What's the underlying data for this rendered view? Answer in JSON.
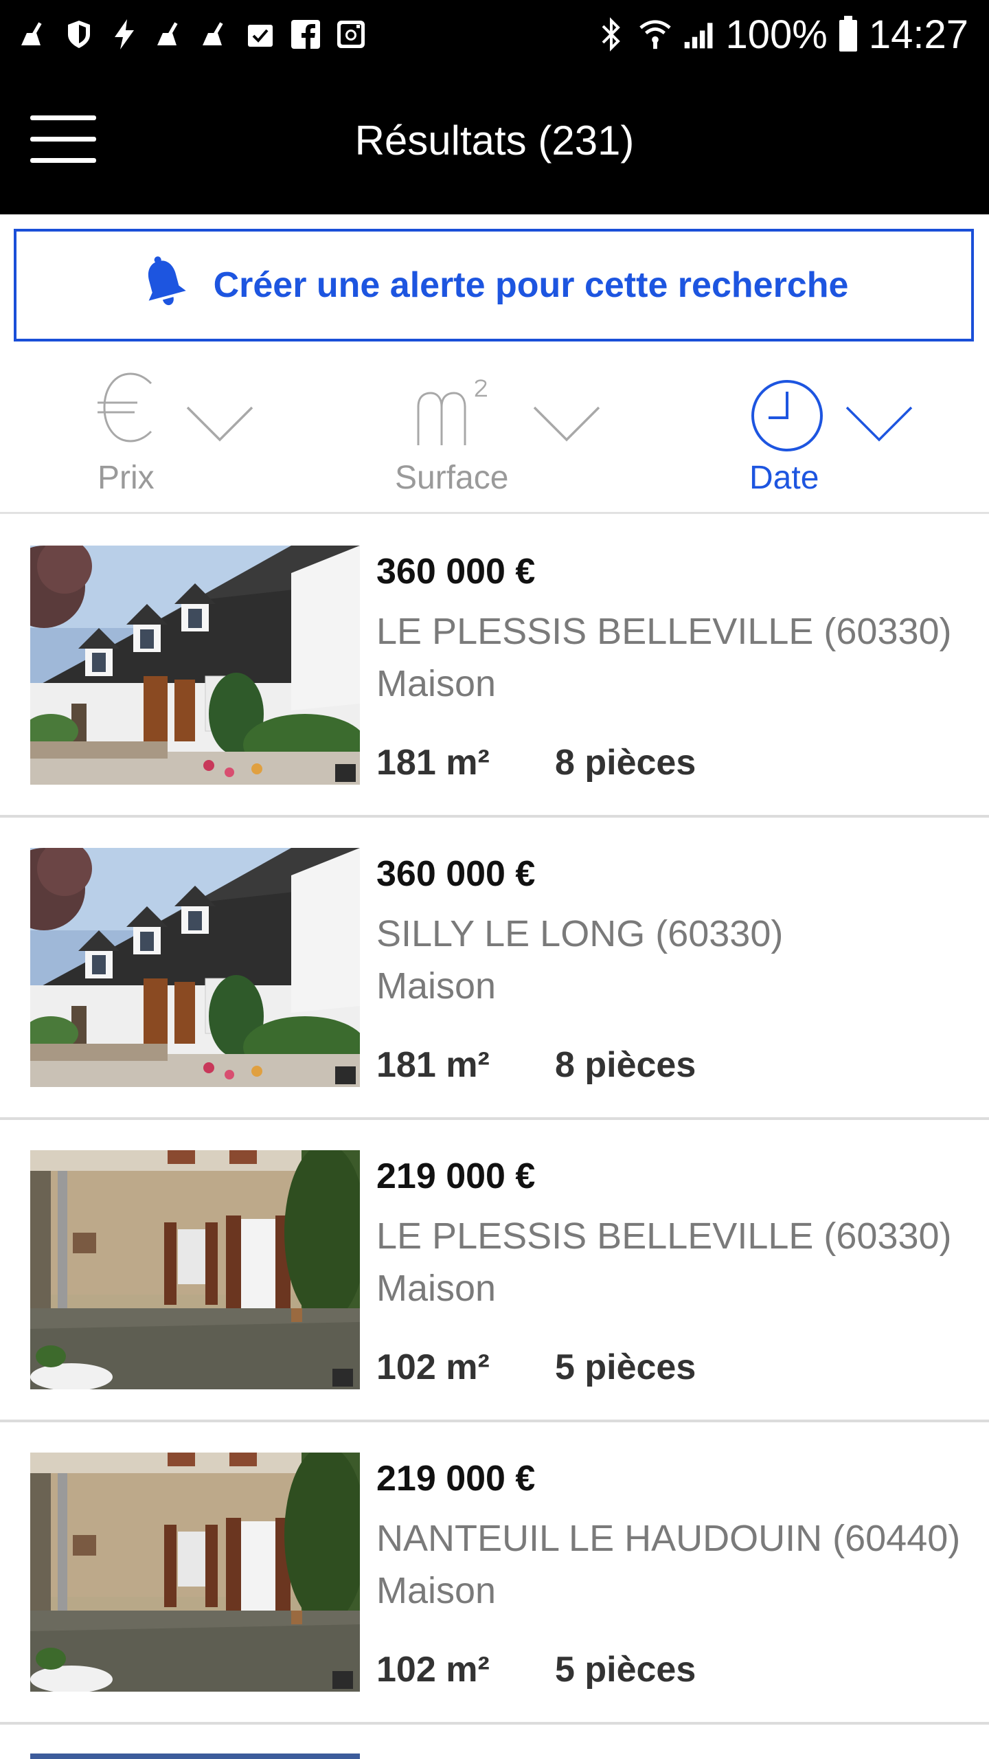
{
  "status_bar": {
    "battery": "100%",
    "time": "14:27"
  },
  "app_bar": {
    "title": "Résultats (231)"
  },
  "alert": {
    "label": "Créer une alerte pour cette recherche"
  },
  "sort": {
    "items": [
      {
        "label": "Prix",
        "active": false
      },
      {
        "label": "Surface",
        "active": false
      },
      {
        "label": "Date",
        "active": true
      }
    ]
  },
  "listings": [
    {
      "price": "360 000 €",
      "city": "LE PLESSIS BELLEVILLE (60330)",
      "type": "Maison",
      "surface": "181 m²",
      "rooms": "8 pièces",
      "image": "house-white-dormers"
    },
    {
      "price": "360 000 €",
      "city": "SILLY LE LONG (60330)",
      "type": "Maison",
      "surface": "181 m²",
      "rooms": "8 pièces",
      "image": "house-white-dormers"
    },
    {
      "price": "219 000 €",
      "city": "LE PLESSIS BELLEVILLE (60330)",
      "type": "Maison",
      "surface": "102 m²",
      "rooms": "5 pièces",
      "image": "stone-courtyard"
    },
    {
      "price": "219 000 €",
      "city": "NANTEUIL LE HAUDOUIN (60440)",
      "type": "Maison",
      "surface": "102 m²",
      "rooms": "5 pièces",
      "image": "stone-courtyard"
    }
  ],
  "colors": {
    "accent": "#1d55e0",
    "header_bg": "#000000",
    "muted_text": "#7a7a7a"
  }
}
